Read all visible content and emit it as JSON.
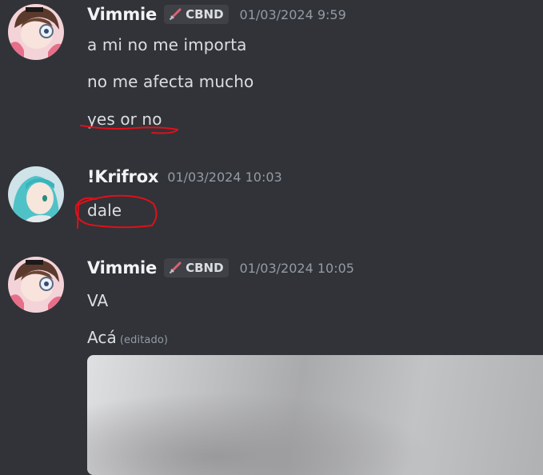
{
  "messages": [
    {
      "username": "Vimmie",
      "tag": "CBND",
      "timestamp": "01/03/2024 9:59",
      "lines": [
        "a mi no me importa",
        "no me afecta mucho",
        "yes or no"
      ]
    },
    {
      "username": "!Krifrox",
      "timestamp": "01/03/2024 10:03",
      "lines": [
        "dale"
      ]
    },
    {
      "username": "Vimmie",
      "tag": "CBND",
      "timestamp": "01/03/2024 10:05",
      "lines": [
        "VA",
        "Acá"
      ],
      "edited_label": "(editado)"
    }
  ],
  "colors": {
    "background": "#313338",
    "annotation": "#e0101a"
  }
}
